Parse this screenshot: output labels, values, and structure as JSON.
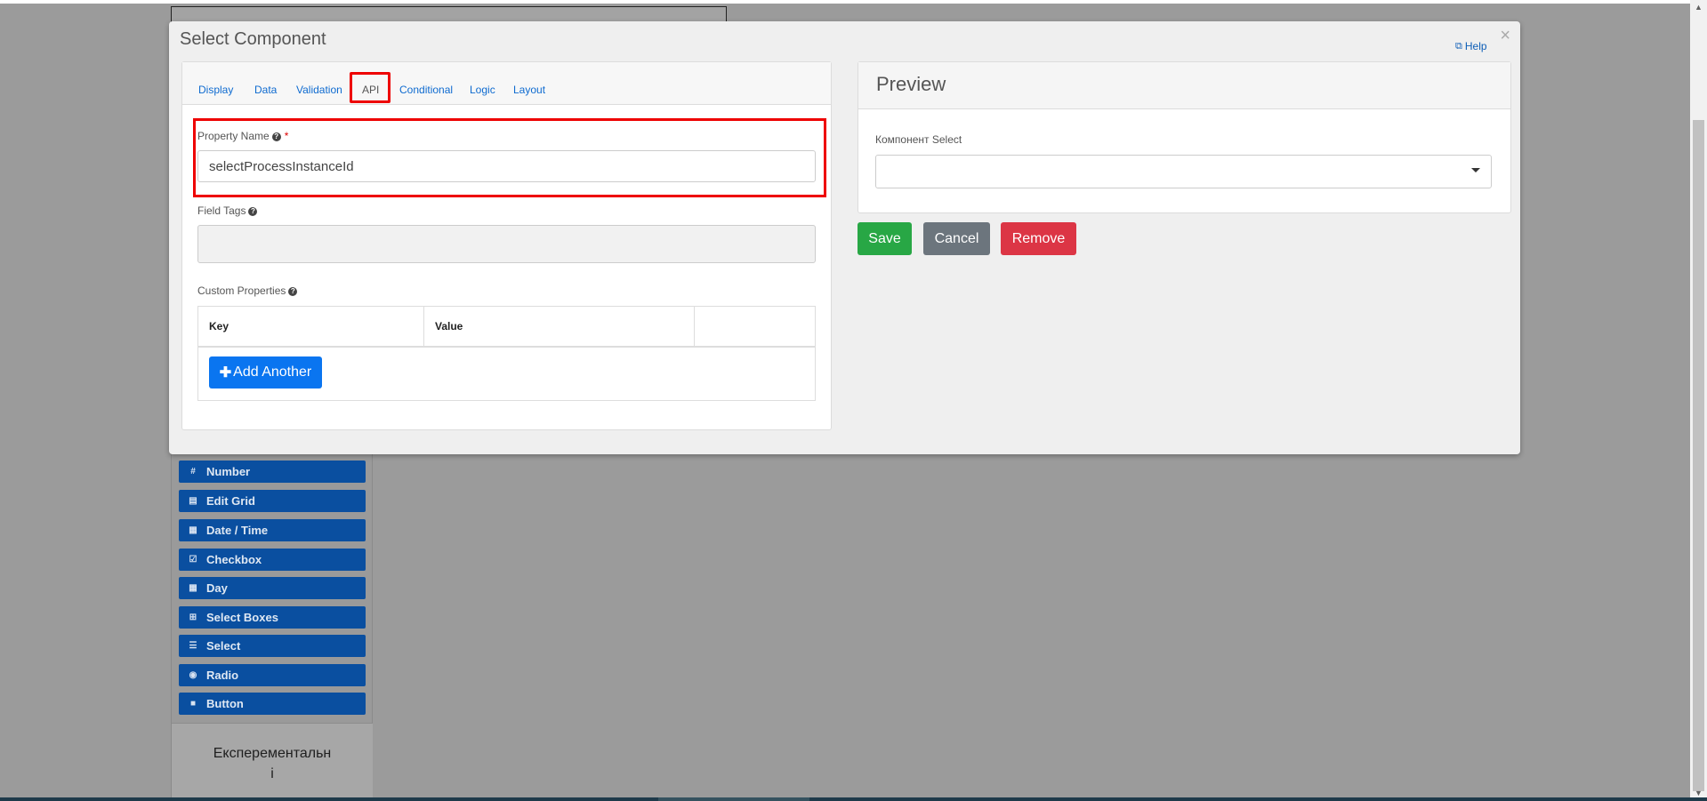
{
  "background": {
    "components": [
      {
        "icon": "#",
        "label": "Number"
      },
      {
        "icon": "▤",
        "label": "Edit Grid"
      },
      {
        "icon": "▦",
        "label": "Date / Time"
      },
      {
        "icon": "☑",
        "label": "Checkbox"
      },
      {
        "icon": "▦",
        "label": "Day"
      },
      {
        "icon": "⊞",
        "label": "Select Boxes"
      },
      {
        "icon": "☰",
        "label": "Select"
      },
      {
        "icon": "◉",
        "label": "Radio"
      },
      {
        "icon": "■",
        "label": "Button"
      }
    ],
    "experimental_group_line1": "Експерементальн",
    "experimental_group_line2": "і"
  },
  "modal": {
    "title": "Select Component",
    "close": "×",
    "help": "Help",
    "tabs": [
      "Display",
      "Data",
      "Validation",
      "API",
      "Conditional",
      "Logic",
      "Layout"
    ],
    "active_tab": "API",
    "property_name": {
      "label": "Property Name",
      "required": "*",
      "value": "selectProcessInstanceId"
    },
    "field_tags": {
      "label": "Field Tags",
      "value": ""
    },
    "custom_properties": {
      "label": "Custom Properties",
      "columns": [
        "Key",
        "Value",
        ""
      ],
      "add_button": "Add Another"
    },
    "preview": {
      "title": "Preview",
      "field_label": "Компонент Select",
      "select_value": ""
    },
    "buttons": {
      "save": "Save",
      "cancel": "Cancel",
      "remove": "Remove"
    },
    "colors": {
      "save": "#28a745",
      "cancel": "#6c757d",
      "remove": "#dc3545",
      "primary": "#0a75f0",
      "highlight": "#ee0000"
    }
  }
}
